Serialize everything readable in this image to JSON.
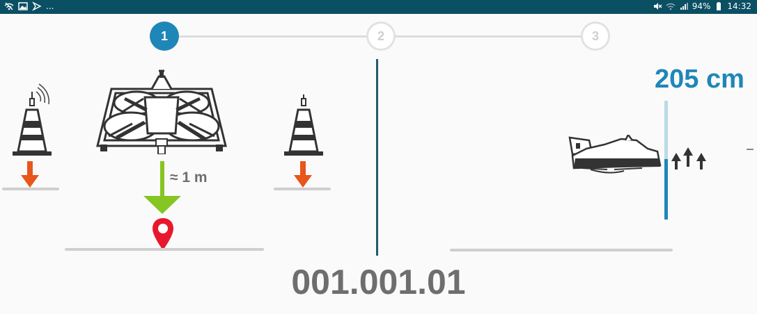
{
  "status_bar": {
    "left_icons": [
      "wifi-off-icon",
      "image-icon",
      "notification-icon"
    ],
    "more": "...",
    "right_icons": [
      "mute-icon",
      "wifi-icon",
      "signal-icon"
    ],
    "battery_percent": "94%",
    "time": "14:32"
  },
  "stepper": {
    "steps": [
      {
        "label": "1",
        "state": "active"
      },
      {
        "label": "2",
        "state": "inactive"
      },
      {
        "label": "3",
        "state": "inactive"
      }
    ],
    "active_color": "#1f86b8"
  },
  "left_panel": {
    "distance_label": "≈ 1 m",
    "icons": [
      "beacon-cone-icon",
      "drone-icon",
      "cone-icon",
      "down-arrow-icon",
      "green-arrow-icon",
      "location-pin-icon"
    ]
  },
  "right_panel": {
    "height_label": "205 cm",
    "icons": [
      "drone-side-icon",
      "up-arrows-icon"
    ],
    "height_bar_color": "#1f86b8"
  },
  "code": "001.001.01"
}
